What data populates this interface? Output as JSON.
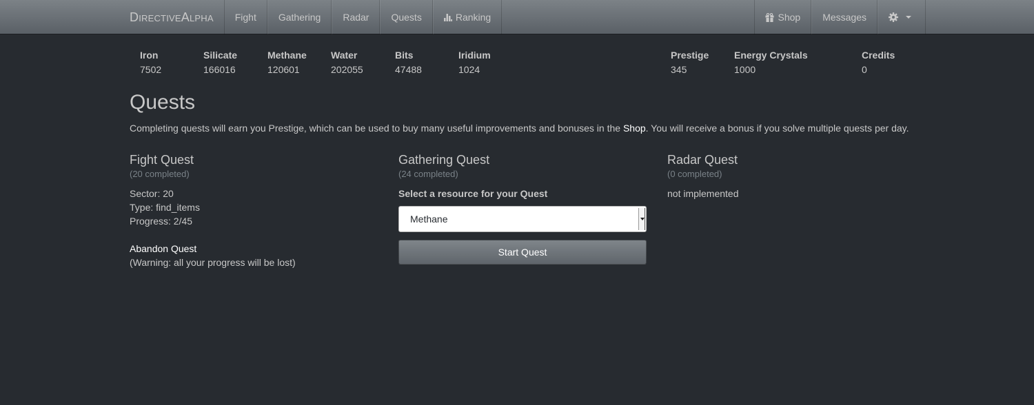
{
  "nav": {
    "brand": "DirectiveAlpha",
    "left_items": [
      {
        "label": "Fight"
      },
      {
        "label": "Gathering"
      },
      {
        "label": "Radar"
      },
      {
        "label": "Quests"
      },
      {
        "label": "Ranking",
        "icon": "bar-chart-icon"
      }
    ],
    "right_items": [
      {
        "label": "Shop",
        "icon": "gift-icon"
      },
      {
        "label": "Messages"
      }
    ],
    "settings_icon": "gear-icon"
  },
  "resources": [
    {
      "name": "Iron",
      "value": "7502"
    },
    {
      "name": "Silicate",
      "value": "166016"
    },
    {
      "name": "Methane",
      "value": "120601"
    },
    {
      "name": "Water",
      "value": "202055"
    },
    {
      "name": "Bits",
      "value": "47488"
    },
    {
      "name": "Iridium",
      "value": "1024"
    },
    {
      "name": "Prestige",
      "value": "345"
    },
    {
      "name": "Energy Crystals",
      "value": "1000"
    },
    {
      "name": "Credits",
      "value": "0"
    }
  ],
  "page": {
    "title": "Quests",
    "desc_before": "Completing quests will earn you Prestige, which can be used to buy many useful improvements and bonuses in the ",
    "desc_link": "Shop",
    "desc_after": ". You will receive a bonus if you solve multiple quests per day."
  },
  "fight": {
    "title": "Fight Quest",
    "completed": "(20 completed)",
    "sector": "Sector: 20",
    "type": "Type: find_items",
    "progress": "Progress: 2/45",
    "abandon_label": "Abandon Quest",
    "warning": "(Warning: all your progress will be lost)"
  },
  "gathering": {
    "title": "Gathering Quest",
    "completed": "(24 completed)",
    "select_label": "Select a resource for your Quest",
    "selected": "Methane",
    "start_label": "Start Quest"
  },
  "radar": {
    "title": "Radar Quest",
    "completed": "(0 completed)",
    "status": "not implemented"
  },
  "colors": {
    "background": "#272b30",
    "navbar": "#6a7075",
    "text": "#c8c8c8",
    "muted": "#7a8288",
    "link": "#ffffff"
  }
}
